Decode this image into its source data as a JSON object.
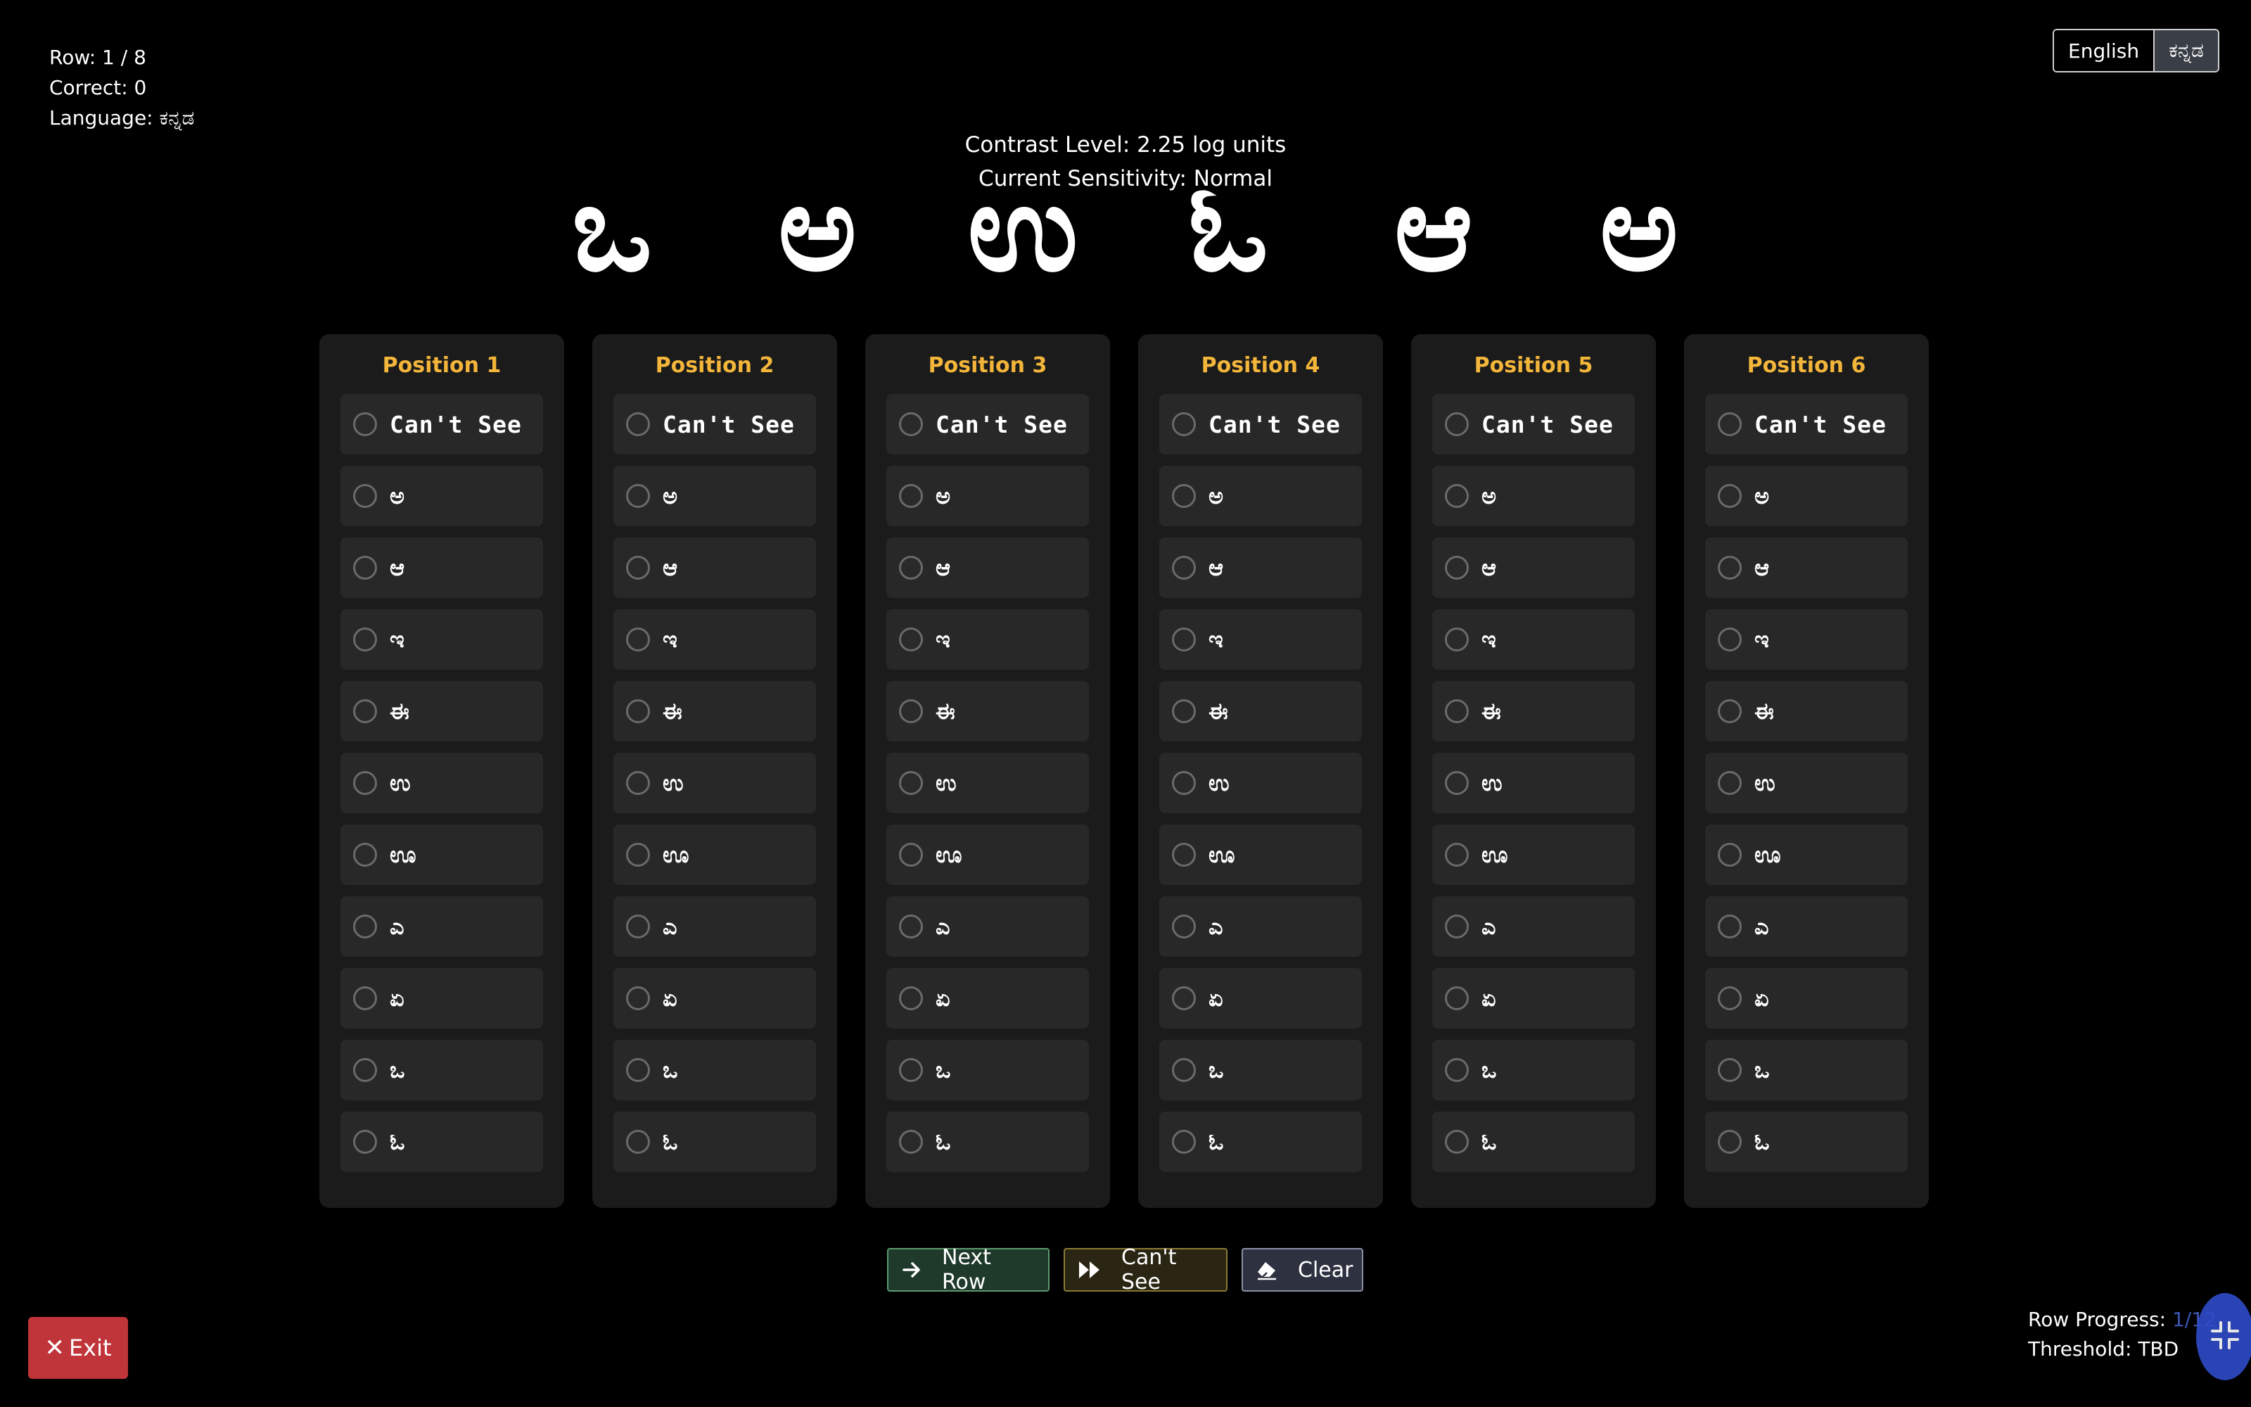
{
  "status": {
    "row": "Row: 1 / 8",
    "correct": "Correct: 0",
    "language": "Language: ಕನ್ನಡ"
  },
  "language_toggle": {
    "options": [
      "English",
      "ಕನ್ನಡ"
    ],
    "selected": "ಕನ್ನಡ"
  },
  "info": {
    "contrast": "Contrast Level: 2.25 log units",
    "sensitivity": "Current Sensitivity: Normal"
  },
  "stimulus": [
    "ಒ",
    "ಅ",
    "ಉ",
    "ಓ",
    "ಆ",
    "ಅ"
  ],
  "columns": [
    {
      "title": "Position 1",
      "options": [
        "Can't See",
        "ಅ",
        "ಆ",
        "ಇ",
        "ಈ",
        "ಉ",
        "ಊ",
        "ಎ",
        "ಏ",
        "ಒ",
        "ಓ"
      ]
    },
    {
      "title": "Position 2",
      "options": [
        "Can't See",
        "ಅ",
        "ಆ",
        "ಇ",
        "ಈ",
        "ಉ",
        "ಊ",
        "ಎ",
        "ಏ",
        "ಒ",
        "ಓ"
      ]
    },
    {
      "title": "Position 3",
      "options": [
        "Can't See",
        "ಅ",
        "ಆ",
        "ಇ",
        "ಈ",
        "ಉ",
        "ಊ",
        "ಎ",
        "ಏ",
        "ಒ",
        "ಓ"
      ]
    },
    {
      "title": "Position 4",
      "options": [
        "Can't See",
        "ಅ",
        "ಆ",
        "ಇ",
        "ಈ",
        "ಉ",
        "ಊ",
        "ಎ",
        "ಏ",
        "ಒ",
        "ಓ"
      ]
    },
    {
      "title": "Position 5",
      "options": [
        "Can't See",
        "ಅ",
        "ಆ",
        "ಇ",
        "ಈ",
        "ಉ",
        "ಊ",
        "ಎ",
        "ಏ",
        "ಒ",
        "ಓ"
      ]
    },
    {
      "title": "Position 6",
      "options": [
        "Can't See",
        "ಅ",
        "ಆ",
        "ಇ",
        "ಈ",
        "ಉ",
        "ಊ",
        "ಎ",
        "ಏ",
        "ಒ",
        "ಓ"
      ]
    }
  ],
  "actions": {
    "next_row": "Next Row",
    "cant_see": "Can't See",
    "clear": "Clear"
  },
  "exit_label": "Exit",
  "progress": {
    "row_progress_label": "Row Progress: ",
    "row_progress_value": "1/12",
    "threshold": "Threshold: TBD"
  },
  "colors": {
    "background": "#000000",
    "column_title": "#f3b53a",
    "exit": "#c0353a",
    "fab": "#2f4cc9"
  },
  "icons": {
    "next_row": "arrow-right-icon",
    "cant_see": "fast-forward-icon",
    "clear": "eraser-icon",
    "exit": "close-icon",
    "fab": "collapse-icon"
  }
}
